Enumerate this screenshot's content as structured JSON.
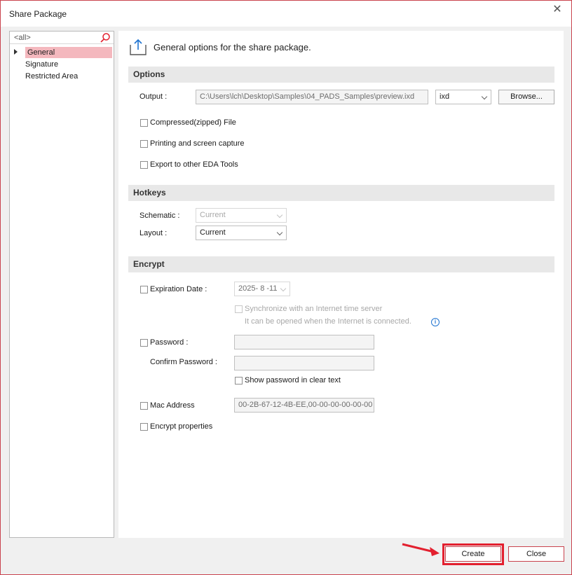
{
  "window": {
    "title": "Share Package"
  },
  "sidebar": {
    "search_text": "<all>",
    "items": [
      {
        "label": "General",
        "selected": true
      },
      {
        "label": "Signature"
      },
      {
        "label": "Restricted Area"
      }
    ]
  },
  "main": {
    "header": "General options for the share package.",
    "options": {
      "section_title": "Options",
      "output_label": "Output :",
      "output_path": "C:\\Users\\lch\\Desktop\\Samples\\04_PADS_Samples\\preview.ixd",
      "format_value": "ixd",
      "browse_label": "Browse...",
      "compressed_label": "Compressed(zipped) File",
      "printing_label": "Printing and screen capture",
      "export_label": "Export to other EDA Tools"
    },
    "hotkeys": {
      "section_title": "Hotkeys",
      "schematic_label": "Schematic :",
      "schematic_value": "Current",
      "layout_label": "Layout :",
      "layout_value": "Current"
    },
    "encrypt": {
      "section_title": "Encrypt",
      "expiration_label": "Expiration Date :",
      "expiration_value": "2025- 8 -11",
      "sync_label": "Synchronize with an Internet time server",
      "sync_note": "It can be opened when the Internet is connected.",
      "password_label": "Password :",
      "confirm_label": "Confirm Password :",
      "show_password_label": "Show password in clear text",
      "mac_label": "Mac Address",
      "mac_value": "00-2B-67-12-4B-EE,00-00-00-00-00-00",
      "encrypt_props_label": "Encrypt properties"
    }
  },
  "footer": {
    "create_label": "Create",
    "close_label": "Close"
  },
  "colors": {
    "accent": "#c9434e",
    "highlight": "#e3202f",
    "selection": "#f4b8be",
    "info": "#1e73d1"
  }
}
